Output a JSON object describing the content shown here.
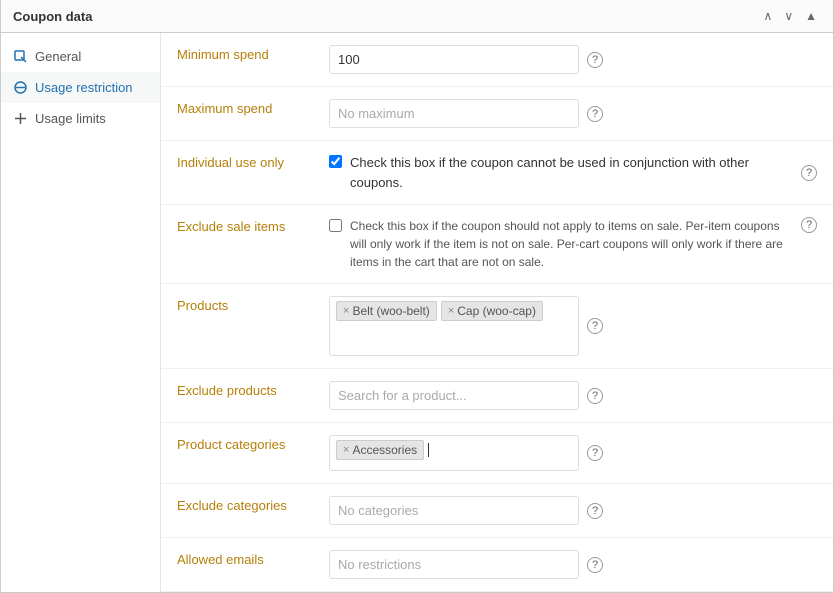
{
  "panel": {
    "title": "Coupon data",
    "controls": {
      "up": "▲",
      "down": "▼",
      "close": "▲"
    }
  },
  "sidebar": {
    "items": [
      {
        "id": "general",
        "label": "General",
        "icon": "tag",
        "active": false
      },
      {
        "id": "usage-restriction",
        "label": "Usage restriction",
        "icon": "block",
        "active": true
      },
      {
        "id": "usage-limits",
        "label": "Usage limits",
        "icon": "plus",
        "active": false
      }
    ]
  },
  "form": {
    "minimum_spend": {
      "label": "Minimum spend",
      "value": "100"
    },
    "maximum_spend": {
      "label": "Maximum spend",
      "value": "",
      "placeholder": "No maximum"
    },
    "individual_use": {
      "label": "Individual use only",
      "checked": true,
      "description": "Check this box if the coupon cannot be used in conjunction with other coupons."
    },
    "exclude_sale": {
      "label": "Exclude sale items",
      "checked": false,
      "description": "Check this box if the coupon should not apply to items on sale. Per-item coupons will only work if the item is not on sale. Per-cart coupons will only work if there are items in the cart that are not on sale."
    },
    "products": {
      "label": "Products",
      "tags": [
        "Belt (woo-belt)",
        "Cap (woo-cap)"
      ]
    },
    "exclude_products": {
      "label": "Exclude products",
      "placeholder": "Search for a product..."
    },
    "product_categories": {
      "label": "Product categories",
      "tags": [
        "Accessories"
      ]
    },
    "exclude_categories": {
      "label": "Exclude categories",
      "placeholder": "No categories"
    },
    "allowed_emails": {
      "label": "Allowed emails",
      "placeholder": "No restrictions"
    }
  },
  "help_icon": "?",
  "icons": {
    "tag": "🏷",
    "block": "⊘",
    "plus": "+"
  }
}
